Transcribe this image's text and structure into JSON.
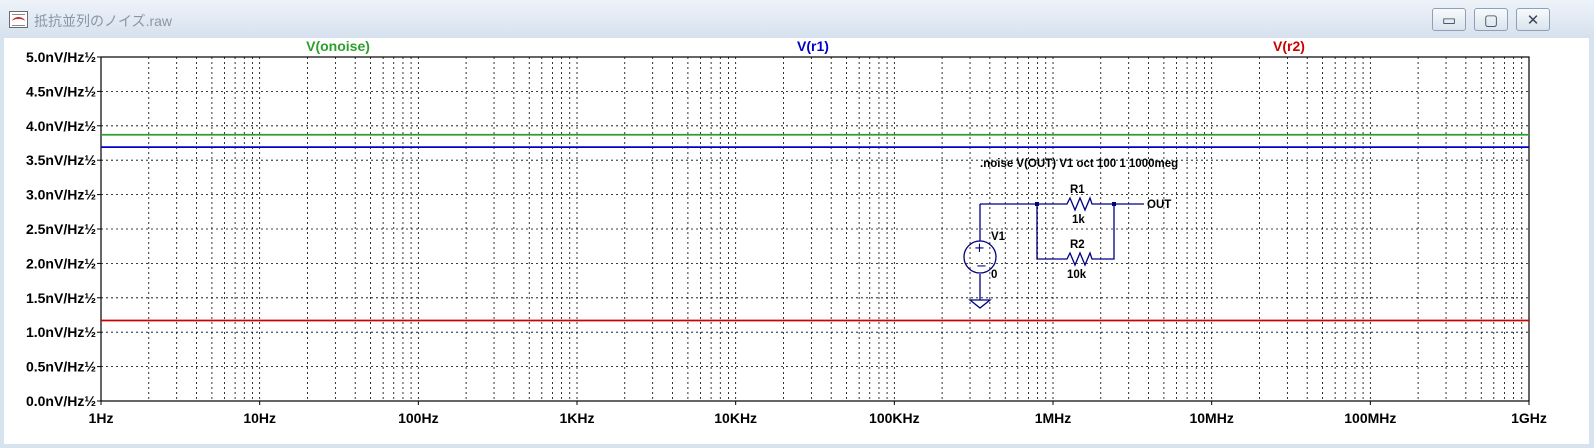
{
  "window": {
    "title": "抵抗並列のノイズ.raw",
    "controls": {
      "minimize": "▭",
      "maximize": "▢",
      "close": "✕"
    }
  },
  "chart_data": {
    "type": "line",
    "xscale": "log",
    "x_ticks": [
      "1Hz",
      "10Hz",
      "100Hz",
      "1KHz",
      "10KHz",
      "100KHz",
      "1MHz",
      "10MHz",
      "100MHz",
      "1GHz"
    ],
    "xlim_hz": [
      1,
      1000000000
    ],
    "y_ticks": [
      "0.0nV/Hz½",
      "0.5nV/Hz½",
      "1.0nV/Hz½",
      "1.5nV/Hz½",
      "2.0nV/Hz½",
      "2.5nV/Hz½",
      "3.0nV/Hz½",
      "3.5nV/Hz½",
      "4.0nV/Hz½",
      "4.5nV/Hz½",
      "5.0nV/Hz½"
    ],
    "ylim": [
      0,
      5
    ],
    "grid": true,
    "series": [
      {
        "name": "V(onoise)",
        "color": "#2ca02c",
        "x": [
          1,
          1000000000
        ],
        "y": [
          3.87,
          3.87
        ]
      },
      {
        "name": "V(r1)",
        "color": "#0000cc",
        "x": [
          1,
          1000000000
        ],
        "y": [
          3.69,
          3.69
        ]
      },
      {
        "name": "V(r2)",
        "color": "#cc0000",
        "x": [
          1,
          1000000000
        ],
        "y": [
          1.17,
          1.17
        ]
      }
    ]
  },
  "schematic": {
    "directive": ".noise V(OUT) V1 oct 100 1 1000meg",
    "r1_name": "R1",
    "r1_value": "1k",
    "r2_name": "R2",
    "r2_value": "10k",
    "v1_name": "V1",
    "v1_value": "0",
    "out_label": "OUT",
    "wire_color": "#000080"
  }
}
